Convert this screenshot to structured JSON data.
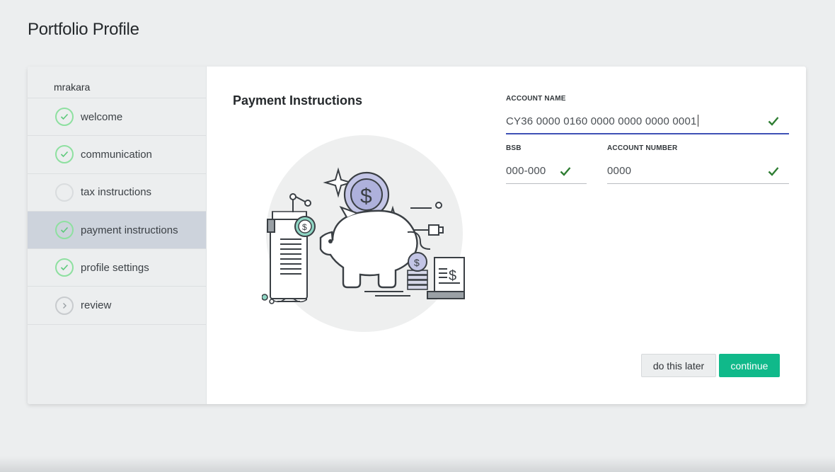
{
  "page": {
    "title": "Portfolio Profile"
  },
  "sidebar": {
    "username": "mrakara",
    "steps": [
      {
        "label": "welcome",
        "status": "done"
      },
      {
        "label": "communication",
        "status": "done"
      },
      {
        "label": "tax instructions",
        "status": "empty"
      },
      {
        "label": "payment instructions",
        "status": "done",
        "active": true
      },
      {
        "label": "profile settings",
        "status": "done"
      },
      {
        "label": "review",
        "status": "next"
      }
    ]
  },
  "main": {
    "section_title": "Payment Instructions",
    "form": {
      "account_name": {
        "label": "ACCOUNT NAME",
        "value": "CY36 0000 0160 0000 0000 0000 0001"
      },
      "bsb": {
        "label": "BSB",
        "value": "000-000"
      },
      "account_number": {
        "label": "ACCOUNT NUMBER",
        "value": "0000"
      }
    },
    "buttons": {
      "later": "do this later",
      "continue": "continue"
    }
  },
  "colors": {
    "accent": "#10b98a",
    "check_green": "#2e7d32",
    "focus_underline": "#3f51b5",
    "active_step": "#cdd3dc",
    "done_ring": "#8ee0a0"
  }
}
